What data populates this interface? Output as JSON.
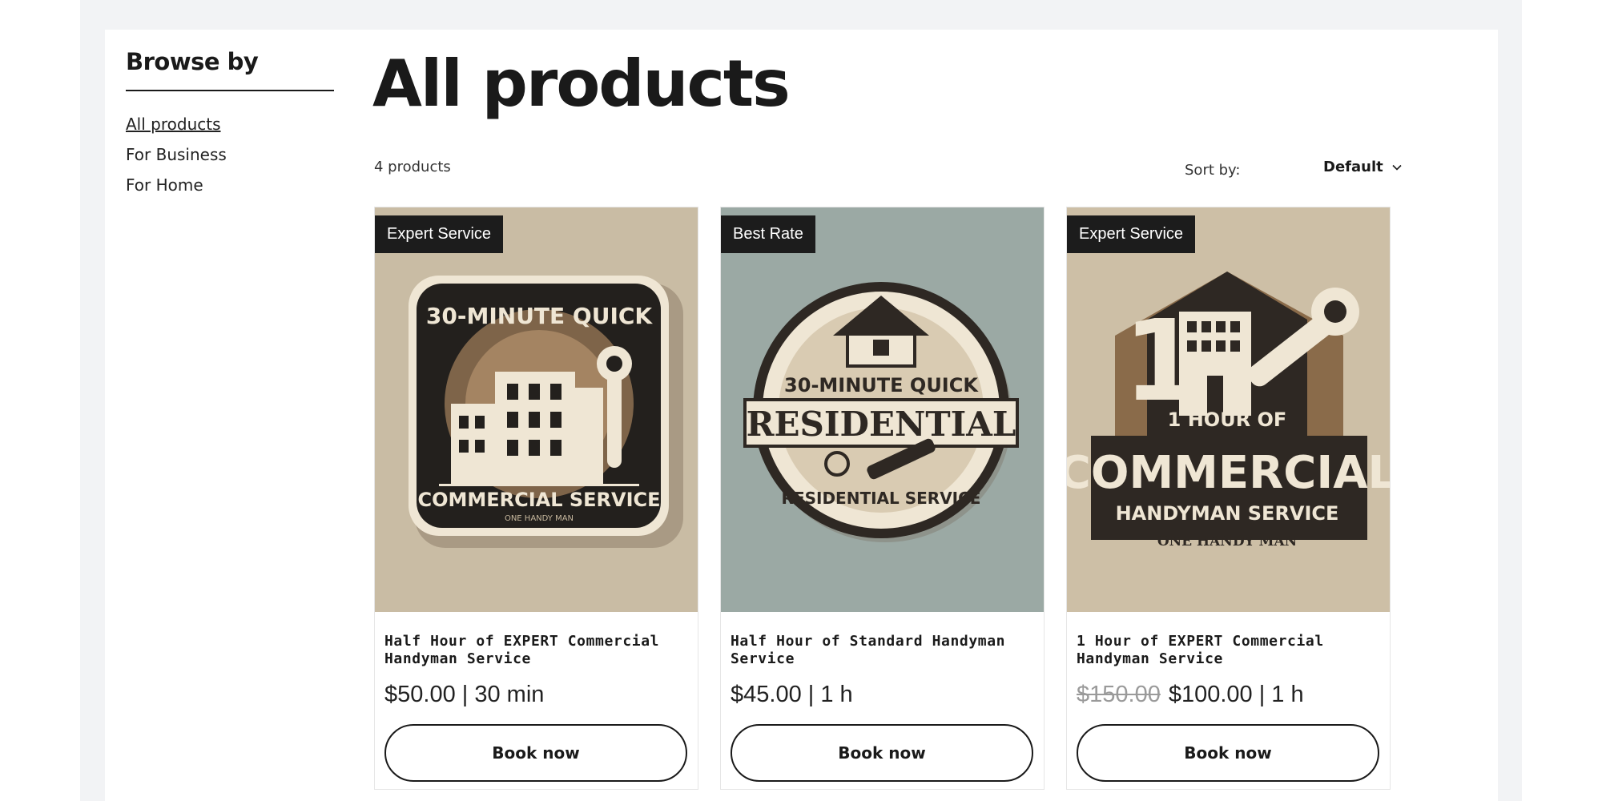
{
  "sidebar": {
    "title": "Browse by",
    "items": [
      {
        "label": "All products"
      },
      {
        "label": "For Business"
      },
      {
        "label": "For Home"
      }
    ]
  },
  "main": {
    "title": "All products",
    "count": "4 products",
    "sort": {
      "label": "Sort by:",
      "value": "Default"
    }
  },
  "products": [
    {
      "ribbon": "Expert Service",
      "name": "Half Hour of EXPERT Commercial Handyman Service",
      "price": "$50.00 | 30 min",
      "old_price": "",
      "button": "Book now",
      "image_text": [
        "30-MINUTE QUICK",
        "COMMERCIAL SERVICE",
        "ONE HANDY MAN"
      ],
      "image_bg": "#c9bca4"
    },
    {
      "ribbon": "Best Rate",
      "name": "Half Hour of Standard Handyman Service",
      "price": "$45.00 | 1 h",
      "old_price": "",
      "button": "Book now",
      "image_text": [
        "30-MINUTE QUICK",
        "RESIDENTIAL",
        "RESIDENTIAL SERVICE"
      ],
      "image_bg": "#9ba9a4"
    },
    {
      "ribbon": "Expert Service",
      "name": "1 Hour of EXPERT Commercial Handyman Service",
      "price": "$100.00 | 1 h",
      "old_price": "$150.00",
      "button": "Book now",
      "image_text": [
        "1 HOUR OF",
        "COMMERCIAL",
        "HANDYMAN SERVICE",
        "ONE HANDY MAN"
      ],
      "image_bg": "#cdbfa6"
    }
  ],
  "colors": {
    "outer_bg": "#f2f3f5",
    "ribbon_bg": "#1c1c1c",
    "text": "#1a1a1a",
    "badge_dark": "#2a2622",
    "badge_cream": "#efe6d4",
    "badge_brown": "#8a6b4a"
  }
}
